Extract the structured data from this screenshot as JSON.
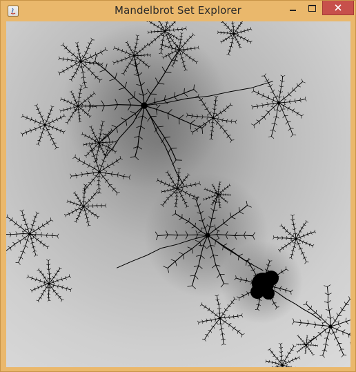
{
  "window": {
    "title": "Mandelbrot Set Explorer",
    "frame_color": "#eab86c",
    "close_button_color": "#c7504b"
  },
  "titlebar_icons": {
    "app": "java-app-icon",
    "minimize": "minimize-icon",
    "maximize": "maximize-icon",
    "close": "close-icon"
  },
  "canvas": {
    "content": "mandelbrot-fractal-rendering",
    "background_color": "#d0d0d0",
    "set_color": "#000000"
  }
}
